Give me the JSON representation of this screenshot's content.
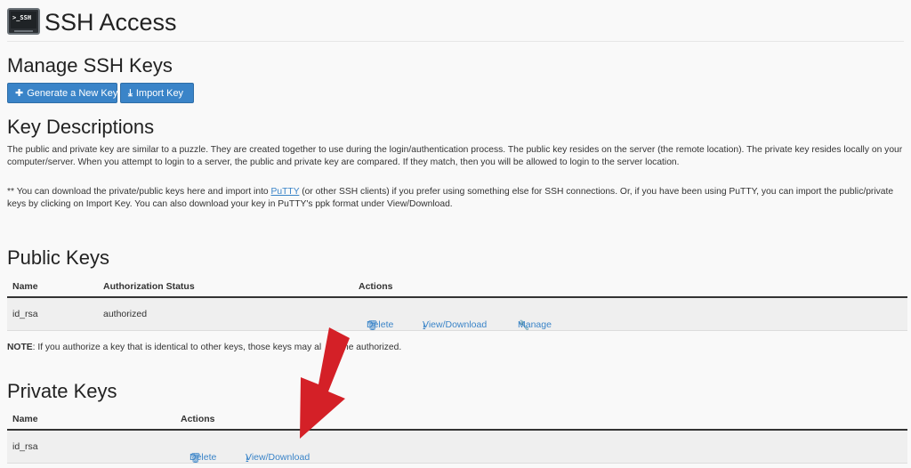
{
  "header": {
    "icon_text": ">_SSH",
    "title": "SSH Access"
  },
  "manage": {
    "heading": "Manage SSH Keys",
    "generate_label": "Generate a New Key",
    "import_label": "Import Key"
  },
  "descriptions": {
    "heading": "Key Descriptions",
    "para1": "The public and private key are similar to a puzzle. They are created together to use during the login/authentication process. The public key resides on the server (the remote location). The private key resides locally on your computer/server. When you attempt to login to a server, the public and private key are compared. If they match, then you will be allowed to login to the server location.",
    "para2_before": "** You can download the private/public keys here and import into ",
    "para2_link": "PuTTY",
    "para2_after": " (or other SSH clients) if you prefer using something else for SSH connections. Or, if you have been using PuTTY, you can import the public/private keys by clicking on Import Key. You can also download your key in PuTTY's ppk format under View/Download."
  },
  "public_keys": {
    "heading": "Public Keys",
    "columns": [
      "Name",
      "Authorization Status",
      "Actions"
    ],
    "rows": [
      {
        "name": "id_rsa",
        "status": "authorized",
        "delete": "Delete",
        "view": "View/Download",
        "manage": "Manage"
      }
    ]
  },
  "note": {
    "label": "NOTE",
    "text": ": If you authorize a key that is identical to other keys, those keys may al",
    "text_tail": "me authorized."
  },
  "private_keys": {
    "heading": "Private Keys",
    "columns": [
      "Name",
      "Actions"
    ],
    "rows": [
      {
        "name": "id_rsa",
        "delete": "Delete",
        "view": "View/Download"
      }
    ]
  },
  "colors": {
    "accent": "#3a84c8",
    "arrow": "#d42027",
    "row_bg": "#efefef"
  },
  "icons": [
    "terminal-icon",
    "plus-icon",
    "import-icon",
    "trash-icon",
    "download-icon",
    "wrench-icon",
    "arrow-annotation"
  ]
}
